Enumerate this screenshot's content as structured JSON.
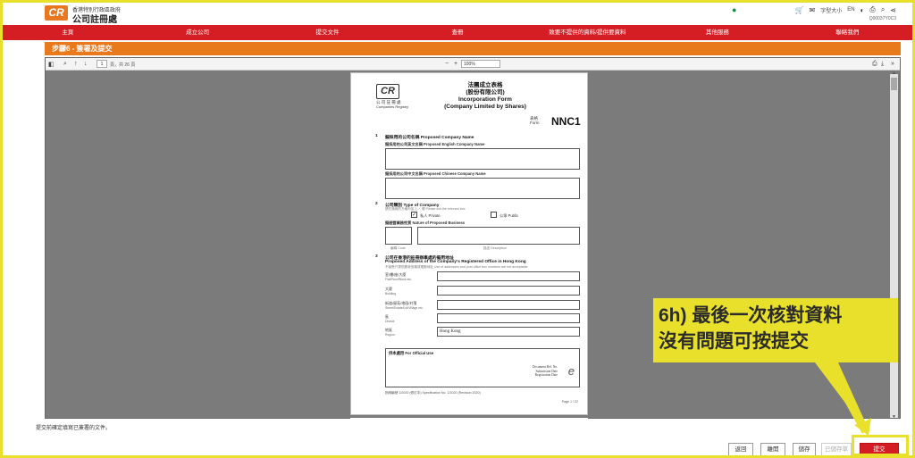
{
  "header": {
    "logo": "CR",
    "brand_sub": "香港特別行政區政府",
    "brand_title": "公司註冊處",
    "font_size": "字型大小",
    "lang": "EN",
    "sub_text": "Q00037Y0C3"
  },
  "nav": {
    "items": [
      "主頁",
      "成立公司",
      "提交文件",
      "查冊",
      "致要不提供的資料/提供要資料",
      "其他服務",
      "聯絡我們"
    ]
  },
  "step": {
    "title": "步驟6 - 簽署及提交"
  },
  "viewer": {
    "page_number": "1",
    "page_of": "頁，共 26 頁",
    "zoom": "100%",
    "zoom_minus": "−",
    "zoom_plus": "+"
  },
  "form": {
    "logo": "CR",
    "logo_zh": "公 司 註 冊 處",
    "logo_en": "Companies Registry",
    "title_zh": "法團成立表格",
    "subtitle_zh": "(股份有限公司)",
    "title_en": "Incorporation Form",
    "subtitle_en": "(Company Limited by Shares)",
    "form_label_zh": "表格",
    "form_label_en": "Form",
    "form_number": "NNC1",
    "sec1_no": "1",
    "sec1_title": "擬採用的公司名稱 Proposed Company Name",
    "sec1_en_label": "擬採用的公司英文名稱 Proposed English Company Name",
    "sec1_zh_label": "擬採用的公司中文名稱 Proposed Chinese Company Name",
    "sec2_no": "2",
    "sec2_title": "公司類別 Type of Company",
    "sec2_hint": "請在適用的方格內加上 ✓ 號 Please tick the relevant box",
    "private_label": "私人 Private",
    "public_label": "公眾 Public",
    "private_check": "✓",
    "business_label": "擬經營業務性質 Nature of Proposed Business",
    "code_label": "編碼 Code",
    "desc_label": "描述 Description",
    "sec3_no": "3",
    "sec3_title_zh": "公司在香港的註冊辦事處的擬用地址",
    "sec3_title_en": "Proposed Address of the Company's Registered Office in Hong Kong",
    "sec3_hint": "不接受只提供郵政信箱或電郵地址 Use of addresses and post office box numbers are not acceptable",
    "addr_flat": "室/樓/座/大廈",
    "addr_flat_en": "Flat/Floor/Block etc.",
    "addr_building": "大廈",
    "addr_building_en": "Building",
    "addr_street": "街道/屋苑/地段/村落",
    "addr_street_en": "Street/Estate/Lot/Village etc.",
    "addr_district": "區",
    "addr_district_en": "District",
    "addr_region": "地區",
    "addr_region_en": "Region",
    "region_value": "Hong Kong",
    "official_title": "供本處用 For Official Use",
    "official_doc": "Document Ref. No.",
    "official_submit": "Submission Date",
    "official_reg": "Registration Date",
    "footer_left": "指明編號 1/2020 (修訂本) Specification No. 1/2020 (Revision 2020)",
    "footer_right": "Page 1 / 22"
  },
  "footnote": "提交前確定填寫已簽署的文件。",
  "buttons": {
    "back": "返回",
    "exit": "離開",
    "save": "儲存",
    "draft": "已儲存草稿",
    "submit": "提交"
  },
  "callout": {
    "line1": "6h) 最後一次核對資料",
    "line2": "沒有問題可按提交"
  },
  "colors": {
    "nav_red": "#d51d24",
    "step_orange": "#e97a1c",
    "highlight_yellow": "#e8e02a",
    "brand_orange": "#e87722"
  }
}
